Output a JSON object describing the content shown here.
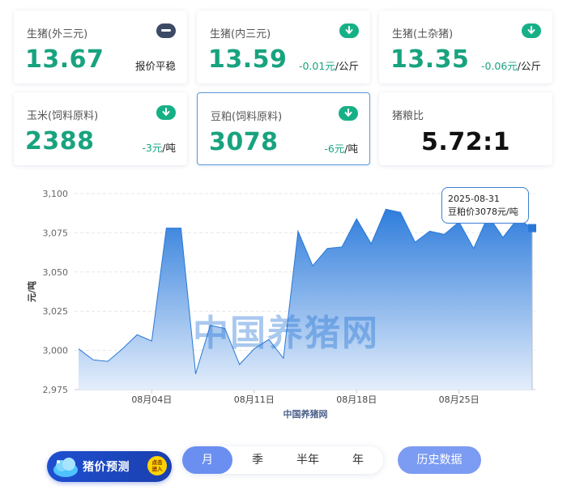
{
  "cards": [
    {
      "name": "生猪(外三元)",
      "value": "13.67",
      "trend": "flat",
      "change": "报价平稳",
      "unit": ""
    },
    {
      "name": "生猪(内三元)",
      "value": "13.59",
      "trend": "down",
      "change": "-0.01元",
      "unit": "/公斤"
    },
    {
      "name": "生猪(土杂猪)",
      "value": "13.35",
      "trend": "down",
      "change": "-0.06元",
      "unit": "/公斤"
    },
    {
      "name": "玉米(饲料原料)",
      "value": "2388",
      "trend": "down",
      "change": "-3元",
      "unit": "/吨"
    },
    {
      "name": "豆粕(饲料原料)",
      "value": "3078",
      "trend": "down",
      "change": "-6元",
      "unit": "/吨",
      "selected": true
    },
    {
      "name": "猪粮比",
      "value": "5.72:1"
    }
  ],
  "icons": {
    "flat": "minus-icon",
    "down": "arrow-down-icon"
  },
  "colors": {
    "accent_green": "#18a37f",
    "chart_line": "#2a78d6",
    "chart_fill_top": "#2f7ddc",
    "chart_fill_bottom": "#e4eefb"
  },
  "chart_data": {
    "type": "area",
    "ylabel": "元/吨",
    "xlabel": "中国养猪网",
    "ylim": [
      2975,
      3100
    ],
    "yticks": [
      "2,975",
      "3,000",
      "3,025",
      "3,050",
      "3,075",
      "3,100"
    ],
    "xticks": [
      {
        "label": "08月04日",
        "index": 5
      },
      {
        "label": "08月11日",
        "index": 12
      },
      {
        "label": "08月18日",
        "index": 19
      },
      {
        "label": "08月25日",
        "index": 26
      }
    ],
    "grid": true,
    "values": [
      3001,
      2994,
      2993,
      3001,
      3010,
      3006,
      3078,
      3078,
      2985,
      3016,
      3014,
      2991,
      3001,
      3007,
      2995,
      3076,
      3054,
      3065,
      3066,
      3084,
      3068,
      3090,
      3088,
      3069,
      3076,
      3074,
      3082,
      3065,
      3086,
      3072,
      3084,
      3078
    ],
    "watermark": "中国养猪网",
    "tooltip": {
      "date": "2025-08-31",
      "text": "豆粕价3078元/吨"
    }
  },
  "bottom": {
    "predict_label": "猪价预测",
    "predict_badge_line1": "点击",
    "predict_badge_line2": "进入",
    "periods": [
      "月",
      "季",
      "半年",
      "年"
    ],
    "active_period": "月",
    "history_label": "历史数据"
  }
}
